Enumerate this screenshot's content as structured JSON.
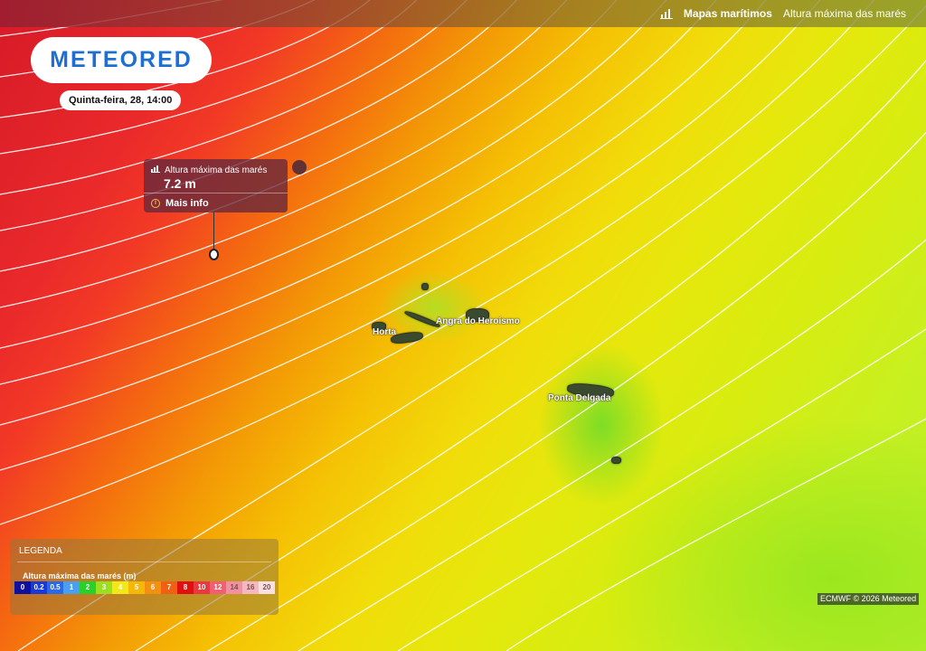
{
  "topbar": {
    "nav_active": "Mapas marítimos",
    "nav_current": "Altura máxima das marés"
  },
  "brand": {
    "logo_text": "METEORED"
  },
  "date": {
    "label": "Quinta-feira, 28, 14:00"
  },
  "popup": {
    "title": "Altura máxima das marés",
    "value": "7.2 m",
    "more": "Mais info"
  },
  "map": {
    "places": [
      "Horta",
      "Angra do Heroísmo",
      "Ponta Delgada"
    ]
  },
  "legend": {
    "title": "LEGENDA",
    "variable": "Altura máxima das marés (m)",
    "scale": [
      {
        "label": "0",
        "color": "#1010a0"
      },
      {
        "label": "0.2",
        "color": "#1a3ad8"
      },
      {
        "label": "0.5",
        "color": "#2a6ae8"
      },
      {
        "label": "1",
        "color": "#4aa0f0"
      },
      {
        "label": "2",
        "color": "#2ad02a"
      },
      {
        "label": "3",
        "color": "#9ae020"
      },
      {
        "label": "4",
        "color": "#f0e818"
      },
      {
        "label": "5",
        "color": "#f5b808"
      },
      {
        "label": "6",
        "color": "#f39010"
      },
      {
        "label": "7",
        "color": "#f06010"
      },
      {
        "label": "8",
        "color": "#e01010"
      },
      {
        "label": "10",
        "color": "#e83840"
      },
      {
        "label": "12",
        "color": "#f06070"
      },
      {
        "label": "14",
        "color": "#f090a0"
      },
      {
        "label": "16",
        "color": "#f5b8c0"
      },
      {
        "label": "20",
        "color": "#fae0e4"
      }
    ]
  },
  "credit": "ECMWF © 2026 Meteored"
}
